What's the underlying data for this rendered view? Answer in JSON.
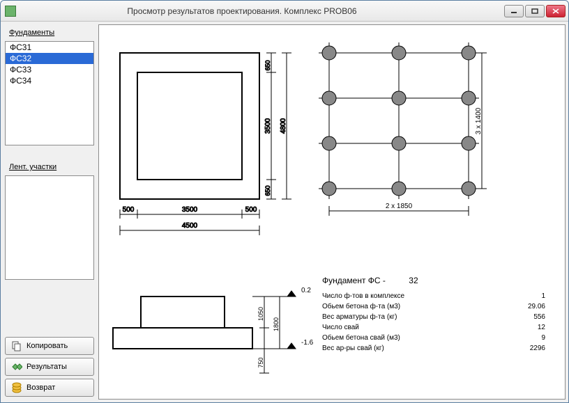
{
  "window": {
    "title": "Просмотр результатов проектирования. Комплекс PROB06"
  },
  "sidebar": {
    "label_foundations": "Фундаменты",
    "items": [
      "ФС31",
      "ФС32",
      "ФС33",
      "ФС34"
    ],
    "selected_index": 1,
    "label_strips": "Лент. участки"
  },
  "buttons": {
    "copy": "Копировать",
    "results": "Результаты",
    "back": "Возврат"
  },
  "plan": {
    "outer_w": "4500",
    "outer_seg_left": "500",
    "outer_seg_mid": "3500",
    "outer_seg_right": "500",
    "inner_h": "3500",
    "outer_h": "4800",
    "top_gap": "650",
    "bottom_gap": "650"
  },
  "pile_grid": {
    "x_label": "2  x  1850",
    "y_label": "3  x  1400"
  },
  "section": {
    "h1": "1050",
    "h2": "1800",
    "h3": "750",
    "top_mark": "0.2",
    "bot_mark": "-1.6"
  },
  "info": {
    "header_prefix": "Фундамент   ФС -",
    "header_num": "32",
    "rows": [
      {
        "label": "Число ф-тов в комплексе",
        "value": "1"
      },
      {
        "label": "Обьем бетона ф-та (м3)",
        "value": "29.06"
      },
      {
        "label": "Вес арматуры ф-та (кг)",
        "value": "556"
      },
      {
        "label": "Число свай",
        "value": "12"
      },
      {
        "label": "Обьем бетона свай (м3)",
        "value": "9"
      },
      {
        "label": "Вес ар-ры свай (кг)",
        "value": "2296"
      }
    ]
  }
}
